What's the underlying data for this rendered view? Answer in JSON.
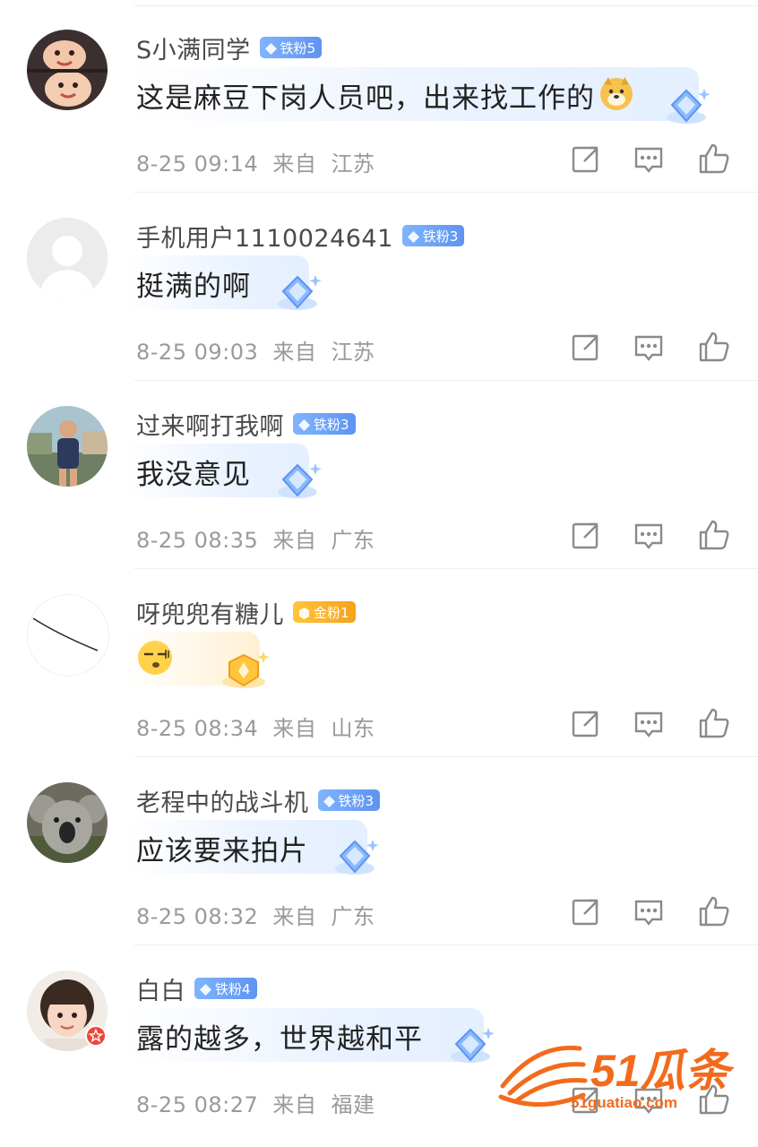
{
  "comments": [
    {
      "username": "S小满同学",
      "badge": "铁粉5",
      "badge_type": "iron",
      "text": "这是麻豆下岗人员吧，出来找工作的",
      "emoji": "doge-emoji",
      "time": "8-25 09:14",
      "from": "来自",
      "location": "江苏"
    },
    {
      "username": "手机用户1110024641",
      "badge": "铁粉3",
      "badge_type": "iron",
      "text": "挺满的啊",
      "emoji": "",
      "time": "8-25 09:03",
      "from": "来自",
      "location": "江苏"
    },
    {
      "username": "过来啊打我啊",
      "badge": "铁粉3",
      "badge_type": "iron",
      "text": "我没意见",
      "emoji": "",
      "time": "8-25 08:35",
      "from": "来自",
      "location": "广东"
    },
    {
      "username": "呀兜兜有糖儿",
      "badge": "金粉1",
      "badge_type": "gold",
      "text": "",
      "emoji": "speechless-emoji",
      "time": "8-25 08:34",
      "from": "来自",
      "location": "山东"
    },
    {
      "username": "老程中的战斗机",
      "badge": "铁粉3",
      "badge_type": "iron",
      "text": "应该要来拍片",
      "emoji": "",
      "time": "8-25 08:32",
      "from": "来自",
      "location": "广东"
    },
    {
      "username": "白白",
      "badge": "铁粉4",
      "badge_type": "iron",
      "text": "露的越多，世界越和平",
      "emoji": "",
      "time": "8-25 08:27",
      "from": "来自",
      "location": "福建"
    }
  ],
  "icons": {
    "repost": "share-square-icon",
    "reply": "comment-bubble-icon",
    "like": "thumbs-up-icon"
  },
  "colors": {
    "iron_badge": "#6fa3f7",
    "gold_badge": "#f7b02a",
    "meta_text": "#9a9a9a",
    "watermark": "#f26b1d"
  },
  "watermark": {
    "brand": "51瓜条",
    "domain": "51guatiao.com"
  }
}
